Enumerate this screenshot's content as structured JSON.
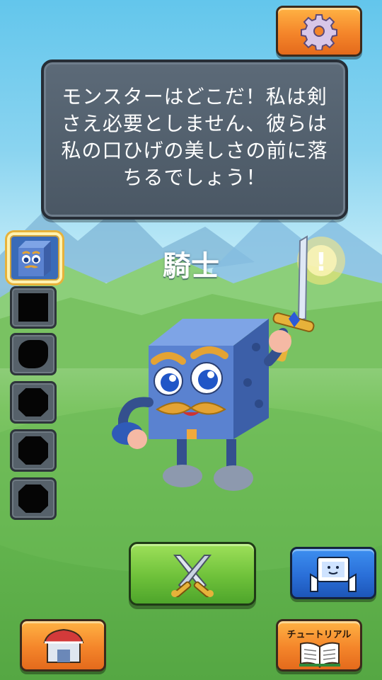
{
  "dialogue": {
    "text": "モンスターはどこだ！私は剣さえ必要としません、彼らは私の口ひげの美しさの前に落ちるでしょう！"
  },
  "character": {
    "name": "騎士",
    "alert_mark": "!"
  },
  "roster": {
    "slots": [
      {
        "state": "unlocked",
        "label": "knight"
      },
      {
        "state": "locked"
      },
      {
        "state": "locked"
      },
      {
        "state": "locked"
      },
      {
        "state": "locked"
      },
      {
        "state": "locked"
      }
    ]
  },
  "buttons": {
    "settings_icon": "gear-icon",
    "battle_icon": "crossed-swords-icon",
    "ar_icon": "hands-tablet-icon",
    "shop_icon": "shop-icon",
    "tutorial_label": "チュートリアル",
    "tutorial_icon": "book-icon"
  },
  "colors": {
    "orange": "#f4852a",
    "green": "#6ec13a",
    "blue": "#2a6fd8",
    "bubble": "#4f5c69",
    "cube": "#4f78c8"
  }
}
